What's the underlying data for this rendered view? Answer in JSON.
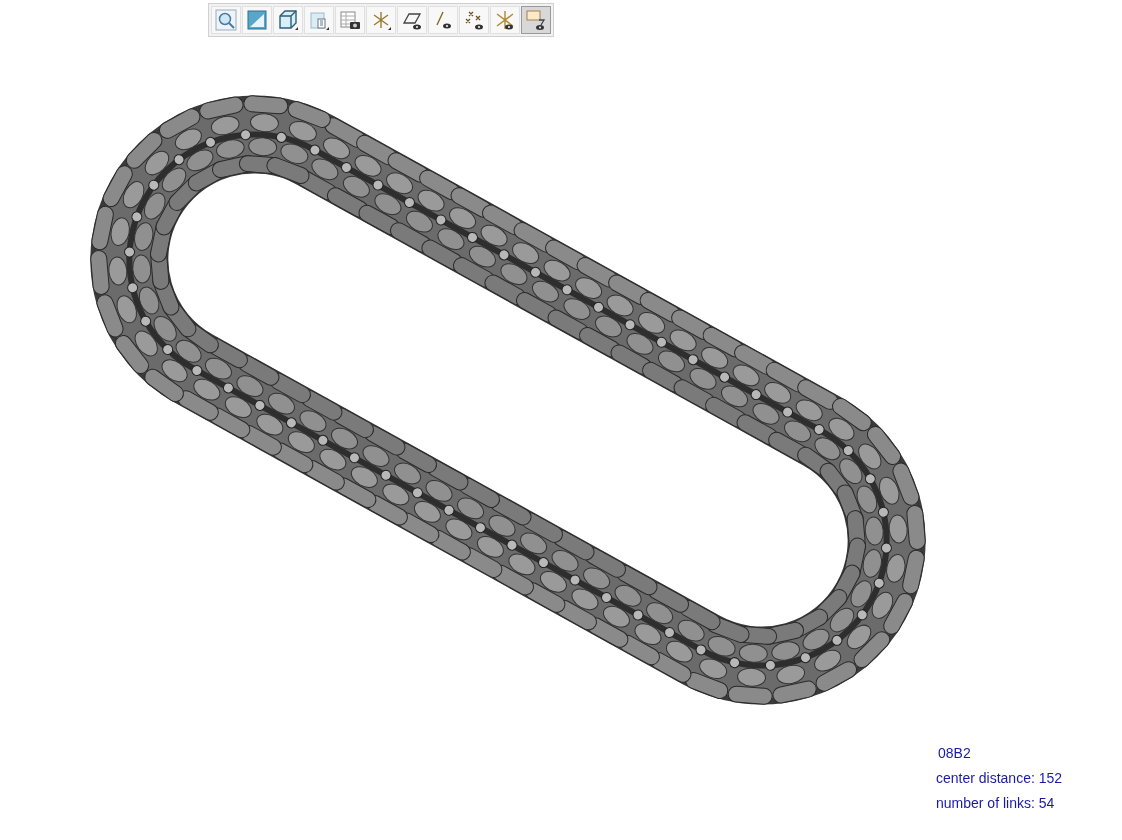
{
  "toolbar": {
    "tools": [
      {
        "kind": "zoom",
        "selected": false
      },
      {
        "kind": "shade",
        "selected": false
      },
      {
        "kind": "cube",
        "selected": false
      },
      {
        "kind": "sheet",
        "selected": false
      },
      {
        "kind": "snapshot",
        "selected": false
      },
      {
        "kind": "axes",
        "selected": false
      },
      {
        "kind": "plane-eye",
        "selected": false
      },
      {
        "kind": "line-eye",
        "selected": false
      },
      {
        "kind": "points-eye",
        "selected": false
      },
      {
        "kind": "axes-eye",
        "selected": false
      },
      {
        "kind": "frame-eye",
        "selected": true
      }
    ]
  },
  "info": {
    "designation": "08B2",
    "center_distance": "center distance: 152",
    "links": "number of links: 54"
  }
}
